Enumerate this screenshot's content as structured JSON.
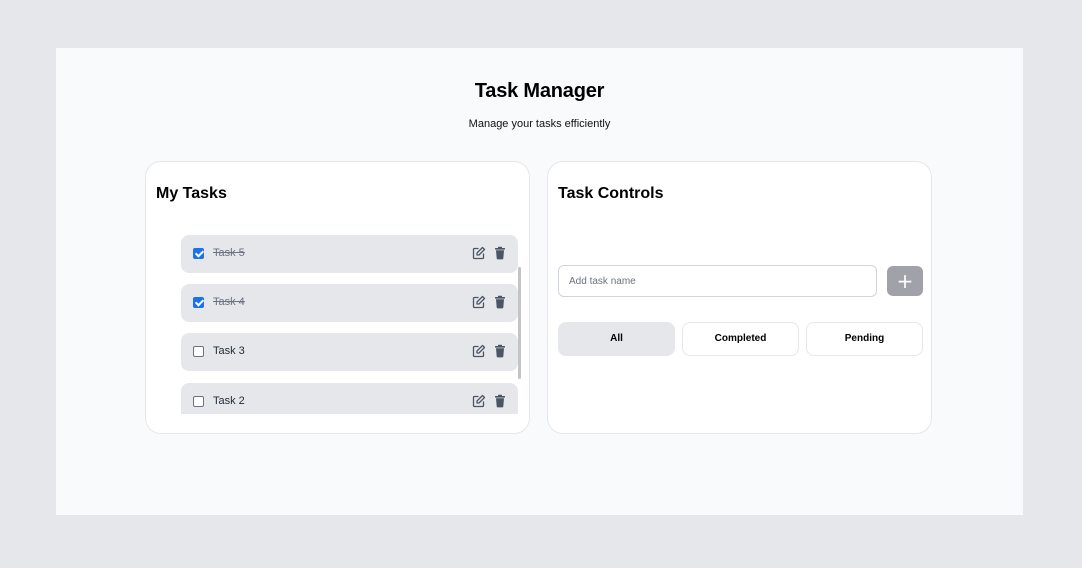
{
  "header": {
    "title": "Task Manager",
    "subtitle": "Manage your tasks efficiently"
  },
  "tasks_panel": {
    "title": "My Tasks",
    "items": [
      {
        "label": "Task 5",
        "completed": true
      },
      {
        "label": "Task 4",
        "completed": true
      },
      {
        "label": "Task 3",
        "completed": false
      },
      {
        "label": "Task 2",
        "completed": false
      }
    ],
    "item_icons": [
      "edit-icon",
      "trash-icon"
    ]
  },
  "controls_panel": {
    "title": "Task Controls",
    "input": {
      "placeholder": "Add task name",
      "value": ""
    },
    "add_button_label": "+",
    "filters": [
      {
        "label": "All",
        "active": true
      },
      {
        "label": "Completed",
        "active": false
      },
      {
        "label": "Pending",
        "active": false
      }
    ]
  },
  "colors": {
    "background": "#e5e7eb",
    "app_background": "#f9fafb",
    "task_item": "#e5e7eb",
    "checkbox_checked": "#1a73e8",
    "add_button": "#a1a1aa",
    "icon": "#4b5563"
  }
}
